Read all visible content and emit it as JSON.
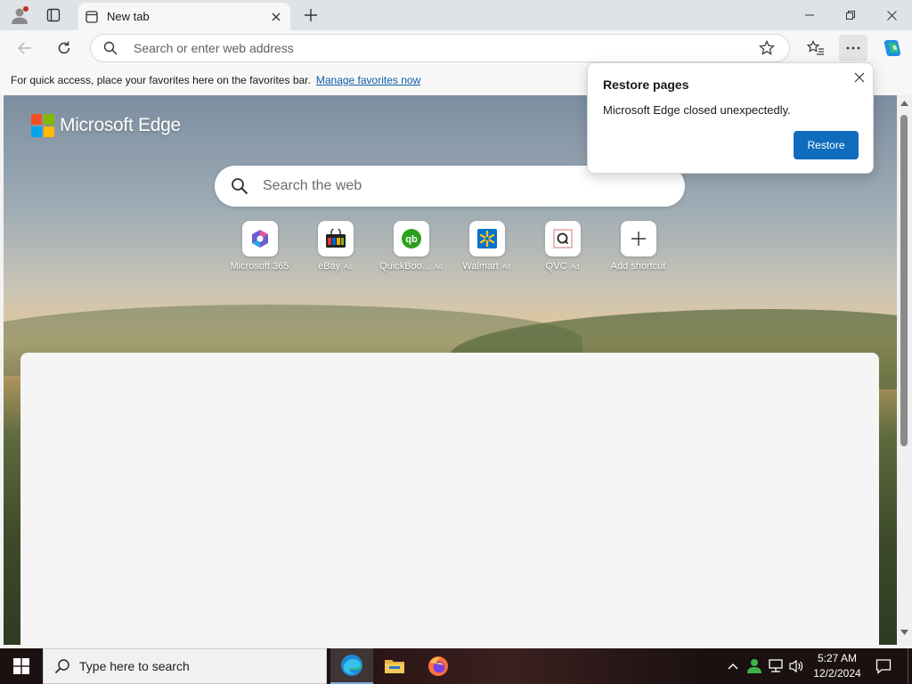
{
  "colors": {
    "accent": "#0f6cbd",
    "titlebar": "#dfe3e8",
    "toolbar": "#f7f7f7",
    "taskbar": "#1b1111"
  },
  "tab": {
    "label": "New tab"
  },
  "address": {
    "placeholder": "Search or enter web address"
  },
  "favorites_bar": {
    "message": "For quick access, place your favorites here on the favorites bar.",
    "link": "Manage favorites now"
  },
  "ntp": {
    "logo_text": "Microsoft Edge",
    "search_placeholder": "Search the web",
    "shortcuts": [
      {
        "label": "Microsoft 365",
        "ad": "",
        "icon": "microsoft365-icon"
      },
      {
        "label": "eBay",
        "ad": "Ad",
        "icon": "ebay-icon"
      },
      {
        "label": "QuickBoo...",
        "ad": "Ad",
        "icon": "quickbooks-icon"
      },
      {
        "label": "Walmart",
        "ad": "Ad",
        "icon": "walmart-icon"
      },
      {
        "label": "QVC",
        "ad": "Ad",
        "icon": "qvc-icon"
      },
      {
        "label": "Add shortcut",
        "ad": "",
        "icon": "plus-icon"
      }
    ]
  },
  "popup": {
    "title": "Restore pages",
    "message": "Microsoft Edge closed unexpectedly.",
    "button": "Restore"
  },
  "taskbar": {
    "search_placeholder": "Type here to search",
    "time": "5:27 AM",
    "date": "12/2/2024"
  }
}
